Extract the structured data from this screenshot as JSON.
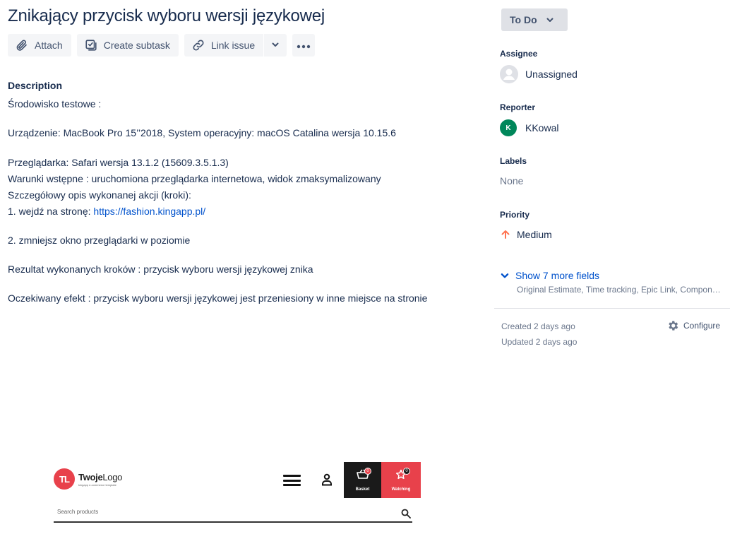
{
  "issue": {
    "title": "Znikający przycisk wyboru wersji językowej"
  },
  "toolbar": {
    "attach_label": "Attach",
    "subtask_label": "Create subtask",
    "link_label": "Link issue"
  },
  "description": {
    "heading": "Description",
    "lines": [
      "Środowisko testowe :",
      "Urządzenie: MacBook Pro 15’’2018, System operacyjny: macOS Catalina wersja 10.15.6",
      "Przeglądarka: Safari wersja 13.1.2 (15609.3.5.1.3)",
      "Warunki wstępne : uruchomiona przeglądarka internetowa, widok zmaksymalizowany",
      "Szczegółowy opis wykonanej akcji (kroki):",
      "1. wejdź na stronę: ",
      "2. zmniejsz okno przeglądarki w poziomie",
      "Rezultat wykonanych kroków : przycisk wyboru wersji językowej znika",
      "Oczekiwany efekt : przycisk wyboru wersji językowej jest przeniesiony w inne miejsce na stronie"
    ],
    "link": "https://fashion.kingapp.pl/"
  },
  "sidebar": {
    "status": "To Do",
    "assignee_label": "Assignee",
    "assignee_value": "Unassigned",
    "reporter_label": "Reporter",
    "reporter_initial": "K",
    "reporter_value": "KKowal",
    "labels_label": "Labels",
    "labels_value": "None",
    "priority_label": "Priority",
    "priority_value": "Medium",
    "more_fields_label": "Show 7 more fields",
    "more_fields_sub": "Original Estimate, Time tracking, Epic Link, Components, Fix versions, Affects versions, Sprint",
    "created": "Created 2 days ago",
    "updated": "Updated 2 days ago",
    "configure_label": "Configure"
  },
  "screenshot": {
    "logo_initials": "TL",
    "logo_name_bold": "Twoje",
    "logo_name_rest": "Logo",
    "logo_tag": "kingapp e-commerce template",
    "basket_label": "Basket",
    "basket_count": "0",
    "watching_label": "Watching",
    "watching_count": "0",
    "search_placeholder": "Search products"
  },
  "colors": {
    "link": "#0052cc",
    "status_bg": "#dfe1e6",
    "reporter_avatar": "#00875a",
    "priority_medium": "#ff7452",
    "brand_red": "#e8414b"
  }
}
